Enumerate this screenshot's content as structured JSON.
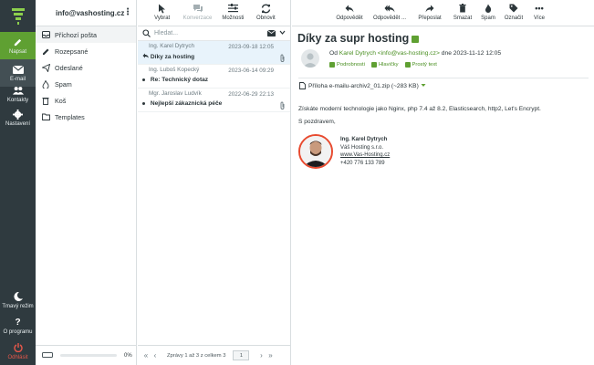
{
  "rail": {
    "compose": "Napsat",
    "email": "E-mail",
    "contacts": "Kontakty",
    "settings": "Nastavení",
    "dark_mode": "Tmavý režim",
    "about": "O programu",
    "logout": "Odhlásit"
  },
  "account": {
    "email": "info@vashosting.cz"
  },
  "folders": [
    {
      "label": "Příchozí pošta",
      "icon": "inbox-icon"
    },
    {
      "label": "Rozepsané",
      "icon": "pencil-icon"
    },
    {
      "label": "Odeslané",
      "icon": "paper-plane-icon"
    },
    {
      "label": "Spam",
      "icon": "fire-icon"
    },
    {
      "label": "Koš",
      "icon": "trash-icon"
    },
    {
      "label": "Templates",
      "icon": "folder-icon"
    }
  ],
  "quota": {
    "percent_label": "0%",
    "percent": 0
  },
  "list_toolbar": {
    "select": "Vybrat",
    "thread": "Konverzace",
    "options": "Možnosti",
    "refresh": "Obnovit"
  },
  "search": {
    "placeholder": "Hledat..."
  },
  "messages": [
    {
      "from": "Ing. Karel Dytrych",
      "date": "2023-09-18 12:05",
      "subject": "Díky za hosting",
      "replied": true,
      "attachment": true
    },
    {
      "from": "Ing. Luboš Kopecký",
      "date": "2023-06-14 09:29",
      "subject": "Re: Technický dotaz",
      "unread": true,
      "attachment": false
    },
    {
      "from": "Mgr. Jaroslav Ludvík",
      "date": "2022-06-29 22:13",
      "subject": "Nejlepší zákaznická péče",
      "unread": true,
      "attachment": true
    }
  ],
  "pagination": {
    "text": "Zprávy 1 až 3 z celkem 3",
    "page": "1"
  },
  "view_toolbar": {
    "reply": "Odpovědět",
    "reply_all": "Odpovědět ...",
    "forward": "Přeposlat",
    "delete": "Smazat",
    "spam": "Spam",
    "mark": "Označit",
    "more": "Více"
  },
  "message": {
    "subject": "Díky za supr hosting",
    "from_prefix": "Od",
    "from": "Karel Dytrych <info@vas-hosting.cz>",
    "date_text": "dne 2023-11-12 12:05",
    "actions": [
      "Podrobnosti",
      "Hlavičky",
      "Prostý text"
    ],
    "attachment": "Příloha e-mailu-archiv2_01.zip (~283 KB)",
    "body": [
      "Získáte moderní technologie jako Nginx, php 7.4 až 8.2, Elasticsearch, http2, Let's Encrypt.",
      "S pozdravem,"
    ],
    "signature": {
      "name": "Ing. Karel Dytrych",
      "company": "Váš Hosting s.r.o.",
      "web": "www.Vas-Hosting.cz",
      "phone": "+420 776 133 789"
    }
  },
  "colors": {
    "accent": "#5fa032",
    "rail": "#2f3a3f",
    "selected_row": "#e8f3fb"
  }
}
